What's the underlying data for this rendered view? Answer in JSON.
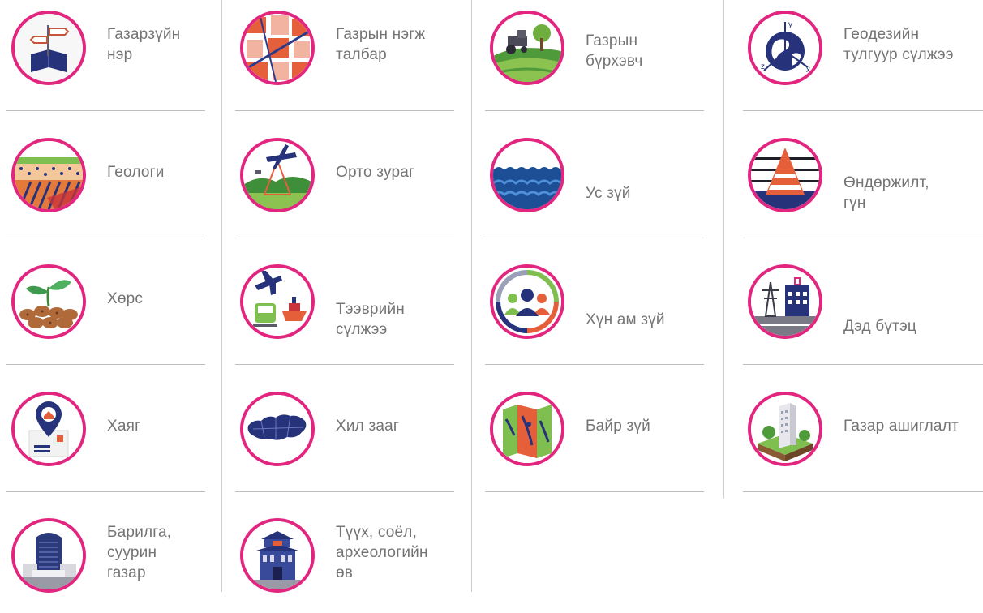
{
  "columns": [
    [
      {
        "label": "Газарзүйн\nнэр",
        "icon": "geographic-names-icon"
      },
      {
        "label": "Геологи",
        "icon": "geology-icon"
      },
      {
        "label": "Хөрс",
        "icon": "soil-icon"
      },
      {
        "label": "Хаяг",
        "icon": "address-icon"
      },
      {
        "label": "Барилга,\nсуурин\nгазар",
        "icon": "buildings-icon"
      }
    ],
    [
      {
        "label": "Газрын нэгж\nталбар",
        "icon": "land-parcel-icon"
      },
      {
        "label": "Орто зураг",
        "icon": "orthoimagery-icon"
      },
      {
        "label": "Тээврийн\nсүлжээ",
        "icon": "transport-network-icon"
      },
      {
        "label": "Хил зааг",
        "icon": "boundaries-icon"
      },
      {
        "label": "Түүх, соёл,\nархеологийн\nөв",
        "icon": "cultural-heritage-icon"
      }
    ],
    [
      {
        "label": "Газрын\nбүрхэвч",
        "icon": "land-cover-icon"
      },
      {
        "label": "Ус зүй",
        "icon": "hydrography-icon"
      },
      {
        "label": "Хүн ам зүй",
        "icon": "demography-icon"
      },
      {
        "label": "Байр зүй",
        "icon": "topography-icon"
      }
    ],
    [
      {
        "label": "Геодезийн\nтулгуур сүлжээ",
        "icon": "geodetic-network-icon"
      },
      {
        "label": "Өндөржилт,\nгүн",
        "icon": "elevation-depth-icon"
      },
      {
        "label": "Дэд бүтэц",
        "icon": "infrastructure-icon"
      },
      {
        "label": "Газар ашиглалт",
        "icon": "land-use-icon"
      }
    ]
  ]
}
